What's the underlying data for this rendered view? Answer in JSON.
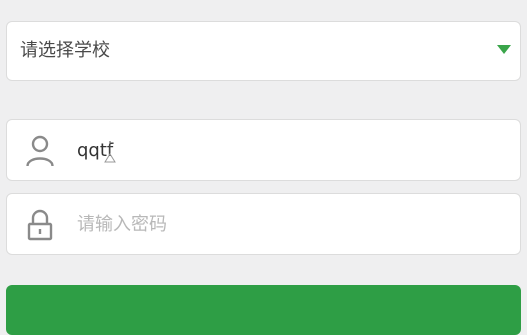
{
  "school_select": {
    "placeholder": "请选择学校",
    "arrow_icon": "triangle-down-icon",
    "arrow_color": "#3aa54a"
  },
  "username": {
    "icon": "user-icon",
    "value": "qqtf"
  },
  "password": {
    "icon": "lock-icon",
    "placeholder": "请输入密码"
  },
  "colors": {
    "background": "#efeff0",
    "card": "#ffffff",
    "accent": "#2e9e45"
  }
}
